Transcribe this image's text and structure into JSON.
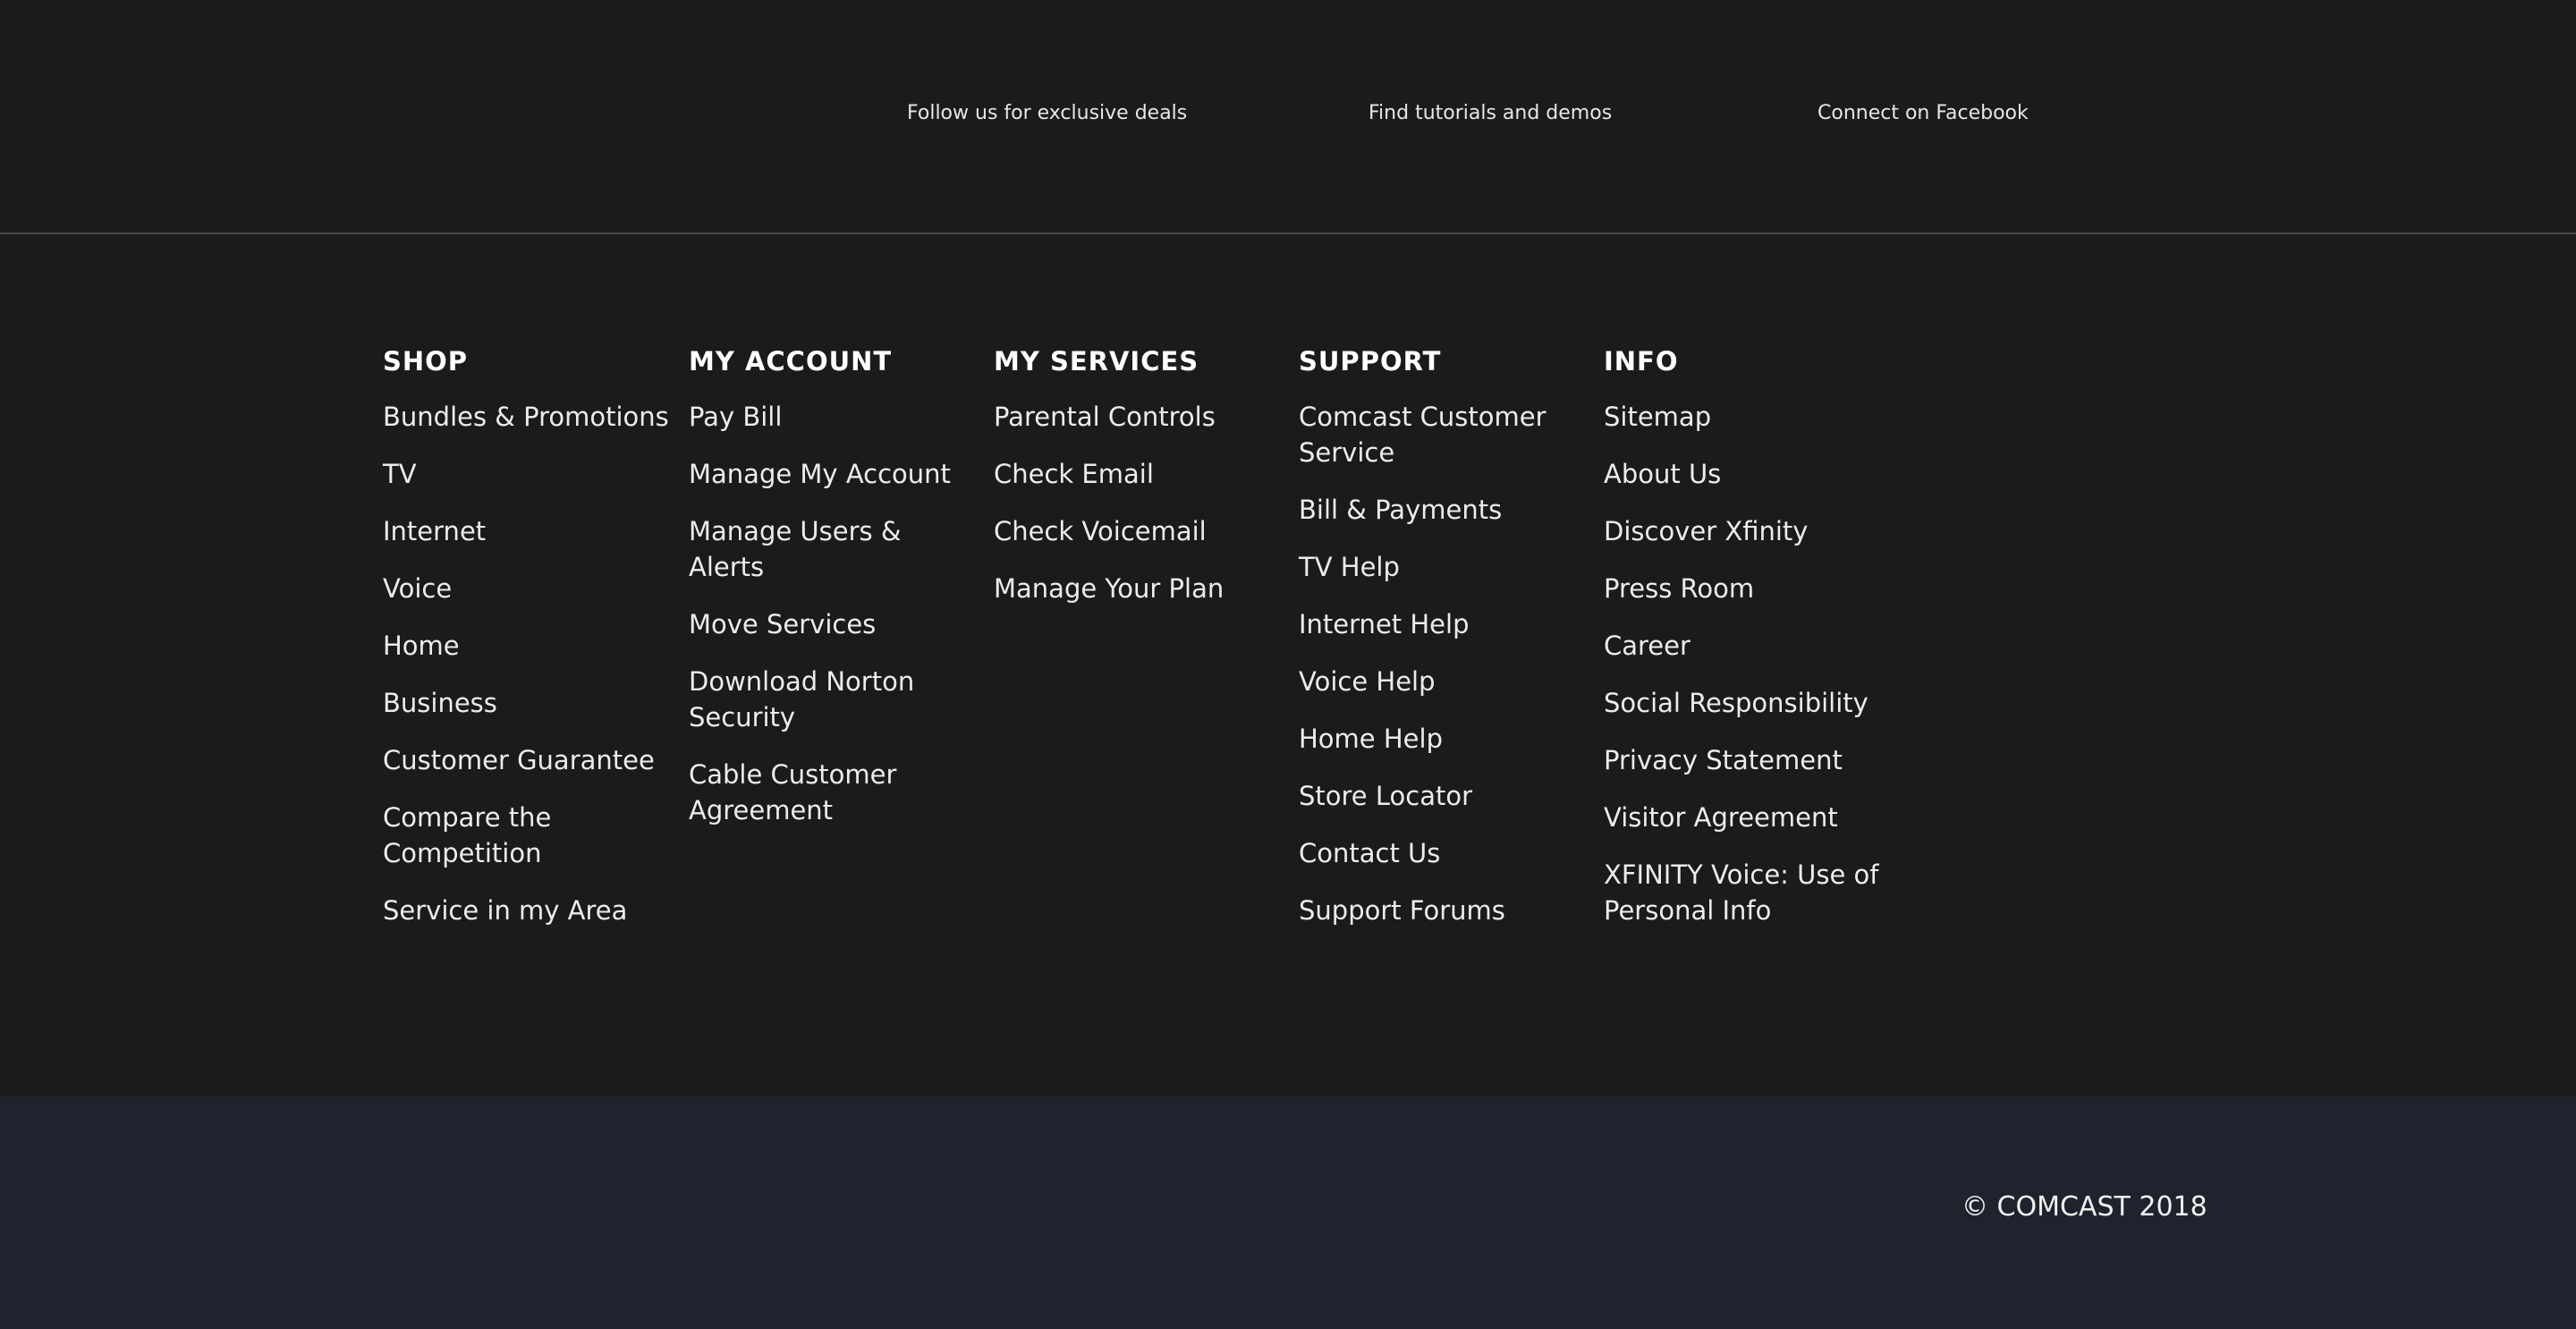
{
  "social": {
    "links": [
      {
        "label": "Follow us for exclusive deals"
      },
      {
        "label": "Find tutorials and demos"
      },
      {
        "label": "Connect on Facebook"
      }
    ]
  },
  "nav": {
    "columns": [
      {
        "heading": "SHOP",
        "items": [
          "Bundles & Promotions",
          "TV",
          "Internet",
          "Voice",
          "Home",
          "Business",
          "Customer Guarantee",
          "Compare the Competition",
          "Service in my Area"
        ]
      },
      {
        "heading": "MY ACCOUNT",
        "items": [
          "Pay Bill",
          "Manage My Account",
          "Manage Users & Alerts",
          "Move Services",
          "Download Norton Security",
          "Cable Customer Agreement"
        ]
      },
      {
        "heading": "MY SERVICES",
        "items": [
          "Parental Controls",
          "Check Email",
          "Check Voicemail",
          "Manage Your Plan"
        ]
      },
      {
        "heading": "SUPPORT",
        "items": [
          "Comcast Customer Service",
          "Bill & Payments",
          "TV Help",
          "Internet Help",
          "Voice Help",
          "Home Help",
          "Store Locator",
          "Contact Us",
          "Support Forums"
        ]
      },
      {
        "heading": "INFO",
        "items": [
          "Sitemap",
          "About Us",
          "Discover Xfinity",
          "Press Room",
          "Career",
          "Social Responsibility",
          "Privacy Statement",
          "Visitor Agreement",
          "XFINITY Voice: Use of Personal Info"
        ]
      }
    ]
  },
  "footer": {
    "copyright": "© COMCAST 2018"
  },
  "colors": {
    "background": "#1b1b1b",
    "bottom_bar": "#20232d",
    "divider": "#4a4a4a",
    "text": "#ffffff"
  }
}
